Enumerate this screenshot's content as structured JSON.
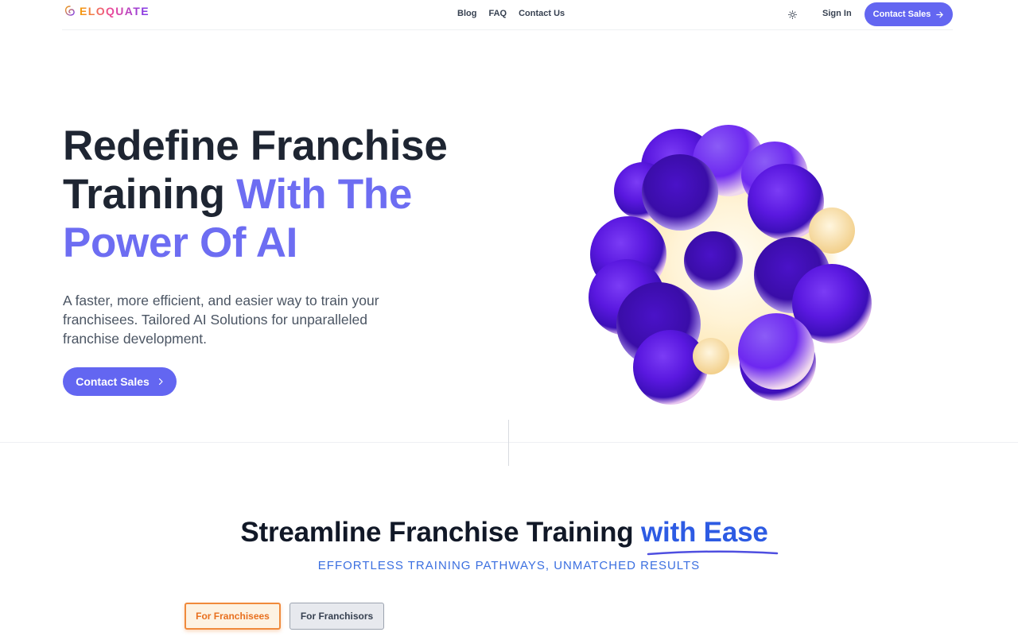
{
  "brand": {
    "name": "ELOQUATE",
    "icon": "logo-swirl-icon"
  },
  "nav": {
    "links": [
      "Blog",
      "FAQ",
      "Contact Us"
    ],
    "theme_icon": "sun-icon",
    "sign_in": "Sign In",
    "cta": "Contact Sales",
    "cta_icon": "arrow-right-icon"
  },
  "hero": {
    "title_line1": "Redefine Franchise",
    "title_line2_plain": "Training ",
    "title_line2_accent": "With The",
    "title_line3_accent": "Power Of AI",
    "subtitle": "A faster, more efficient, and easier way to train your franchisees. Tailored AI Solutions for unparalleled franchise development.",
    "cta": "Contact Sales",
    "cta_icon": "chevron-right-icon",
    "illustration": "purple-sphere-cluster"
  },
  "section2": {
    "title_plain": "Streamline Franchise Training ",
    "title_accent": "with Ease",
    "subtitle": "EFFORTLESS TRAINING PATHWAYS, UNMATCHED RESULTS",
    "tabs": [
      {
        "label": "For Franchisees",
        "active": true
      },
      {
        "label": "For Franchisors",
        "active": false
      }
    ]
  },
  "colors": {
    "primary": "#6366f1",
    "accent_text": "#6d6df2",
    "blue_accent": "#2d5be3",
    "tab_active": "#f08a3c"
  }
}
